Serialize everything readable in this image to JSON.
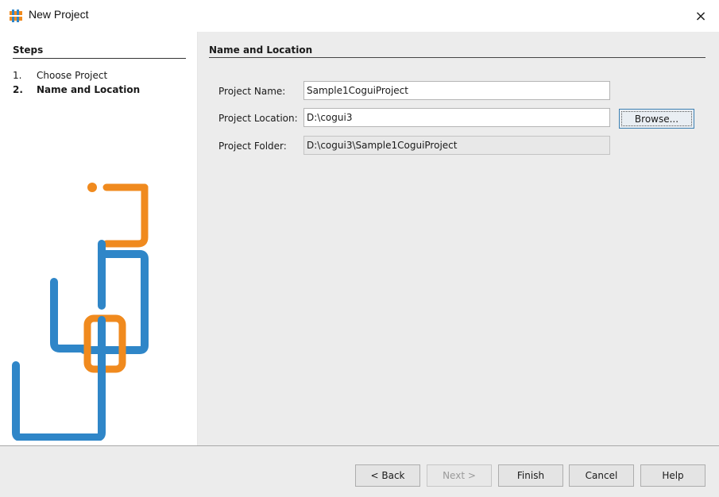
{
  "window": {
    "title": "New Project",
    "close_icon": "×"
  },
  "steps": {
    "title": "Steps",
    "items": [
      {
        "number": "1.",
        "label": "Choose Project",
        "active": false
      },
      {
        "number": "2.",
        "label": "Name and Location",
        "active": true
      }
    ]
  },
  "content": {
    "section_title": "Name and Location",
    "project_name": {
      "label": "Project Name:",
      "value": "Sample1CoguiProject"
    },
    "project_location": {
      "label": "Project Location:",
      "value": "D:\\cogui3"
    },
    "project_folder": {
      "label": "Project Folder:",
      "value": "D:\\cogui3\\Sample1CoguiProject"
    },
    "browse_label": "Browse..."
  },
  "buttons": {
    "back": "< Back",
    "next": "Next >",
    "finish": "Finish",
    "cancel": "Cancel",
    "help": "Help"
  },
  "colors": {
    "logo_blue": "#2f86c8",
    "logo_orange": "#f08a1e",
    "focus_border": "#3c7fb1"
  }
}
